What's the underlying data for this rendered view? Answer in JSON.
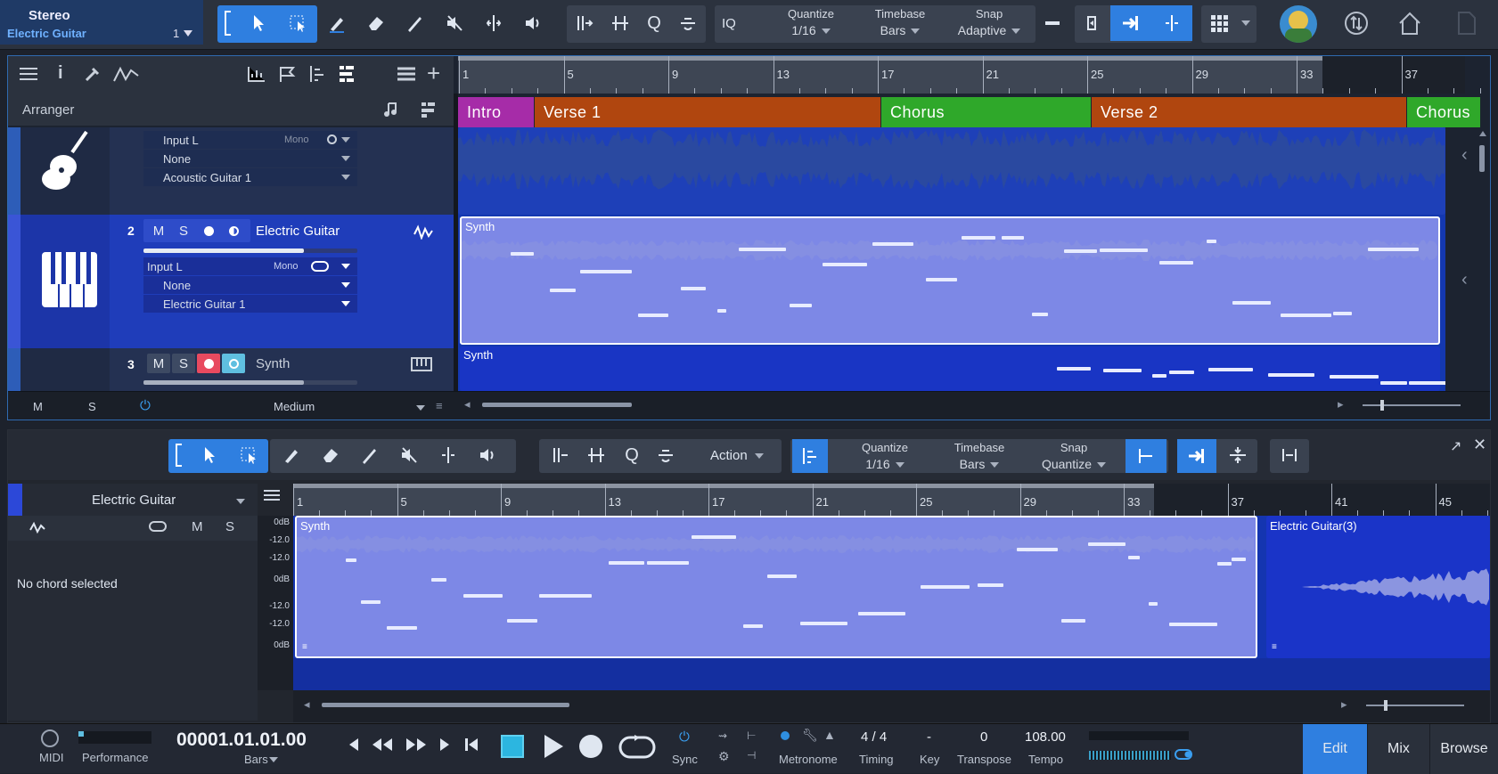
{
  "header": {
    "output": "Stereo",
    "track": "Electric Guitar",
    "channel": "1"
  },
  "toolbar": {
    "quantize": {
      "label": "Quantize",
      "value": "1/16"
    },
    "timebase": {
      "label": "Timebase",
      "value": "Bars"
    },
    "snap": {
      "label": "Snap",
      "value": "Adaptive"
    },
    "iq": "IQ"
  },
  "arranger": {
    "label": "Arranger",
    "ruler": [
      "1",
      "5",
      "9",
      "13",
      "17",
      "21",
      "25",
      "29",
      "33",
      "37"
    ],
    "sections": [
      {
        "name": "Intro",
        "color": "#a62ca8"
      },
      {
        "name": "Verse 1",
        "color": "#b0460f"
      },
      {
        "name": "Chorus",
        "color": "#2fa82a"
      },
      {
        "name": "Verse 2",
        "color": "#b0460f"
      },
      {
        "name": "Chorus",
        "color": "#2fa82a"
      }
    ],
    "tracks": [
      {
        "num": "",
        "name": "",
        "input": "Input L",
        "mode": "Mono",
        "send": "None",
        "output": "Acoustic Guitar 1"
      },
      {
        "num": "2",
        "name": "Electric Guitar",
        "input": "Input L",
        "mode": "Mono",
        "send": "None",
        "output": "Electric Guitar 1",
        "event": "Synth"
      },
      {
        "num": "3",
        "name": "Synth",
        "event": "Synth"
      }
    ],
    "footer": {
      "m": "M",
      "s": "S",
      "size": "Medium"
    }
  },
  "editor": {
    "action": "Action",
    "quantize": {
      "label": "Quantize",
      "value": "1/16"
    },
    "timebase": {
      "label": "Timebase",
      "value": "Bars"
    },
    "snap": {
      "label": "Snap",
      "value": "Quantize"
    },
    "track": "Electric Guitar",
    "m": "M",
    "s": "S",
    "chord": "No chord selected",
    "ruler": [
      "1",
      "5",
      "9",
      "13",
      "17",
      "21",
      "25",
      "29",
      "33",
      "37",
      "41",
      "45"
    ],
    "db": [
      "0dB",
      "-12.0",
      "-12.0",
      "0dB",
      "-12.0",
      "-12.0",
      "0dB"
    ],
    "event1": "Synth",
    "event2": "Electric Guitar(3)"
  },
  "transport": {
    "midi": "MIDI",
    "performance": "Performance",
    "time": "00001.01.01.00",
    "time_unit": "Bars",
    "sync": "Sync",
    "metronome": "Metronome",
    "timing_value": "4 / 4",
    "timing": "Timing",
    "key_value": "-",
    "key": "Key",
    "transpose_value": "0",
    "transpose": "Transpose",
    "tempo_value": "108.00",
    "tempo": "Tempo",
    "tabs": [
      "Edit",
      "Mix",
      "Browse"
    ]
  }
}
